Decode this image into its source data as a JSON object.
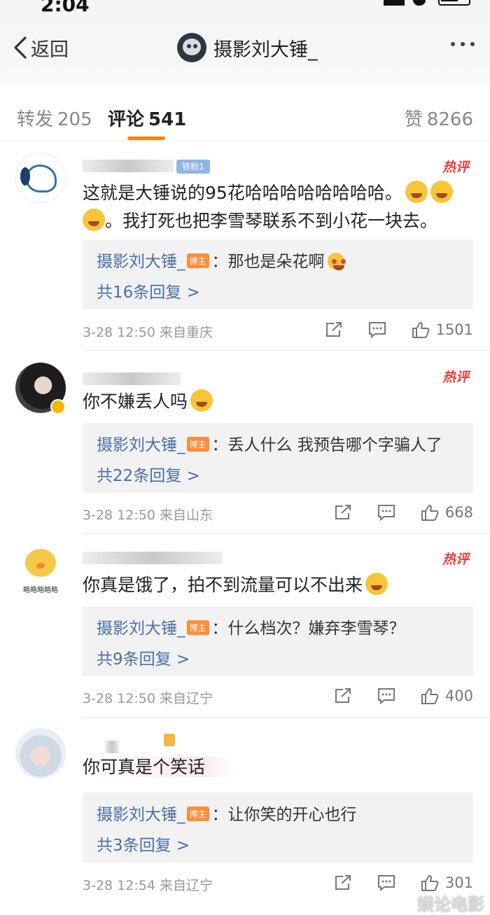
{
  "status": {
    "time": "2:04"
  },
  "nav": {
    "back_label": "返回",
    "title": "摄影刘大锤_"
  },
  "tabs": {
    "repost_label": "转发",
    "repost_count": "205",
    "comment_label": "评论",
    "comment_count": "541",
    "like_label": "赞",
    "like_count": "8266"
  },
  "comments": [
    {
      "fan_badge": "铁粉1",
      "hot_label": "热评",
      "text_part1": "这就是大锤说的95花哈哈哈哈哈哈哈哈。",
      "text_part2": "。我打死也把李雪琴联系不到小花一块去。",
      "reply": {
        "author": "摄影刘大锤_",
        "badge": "博主",
        "text": "：那也是朵花啊",
        "more": "共16条回复 >"
      },
      "time": "3-28 12:50",
      "source": "来自重庆",
      "likes": "1501"
    },
    {
      "hot_label": "热评",
      "text": "你不嫌丢人吗",
      "reply": {
        "author": "摄影刘大锤_",
        "badge": "博主",
        "text": "：丢人什么 我预告哪个字骗人了",
        "more": "共22条回复 >"
      },
      "time": "3-28 12:50",
      "source": "来自山东",
      "likes": "668"
    },
    {
      "hot_label": "热评",
      "avatar_caption": "略略略略略",
      "text": "你真是饿了，拍不到流量可以不出来",
      "reply": {
        "author": "摄影刘大锤_",
        "badge": "博主",
        "text": "：什么档次？嫌弃李雪琴？",
        "more": "共9条回复 >"
      },
      "time": "3-28 12:50",
      "source": "来自辽宁",
      "likes": "400"
    },
    {
      "text": "你可真是个笑话",
      "reply": {
        "author": "摄影刘大锤_",
        "badge": "博主",
        "text": "：让你笑的开心也行",
        "more": "共3条回复 >"
      },
      "time": "3-28 12:54",
      "source": "来自辽宁",
      "likes": "301"
    }
  ],
  "watermark": "娱论电影",
  "icons": [
    "back-chevron-icon",
    "more-dots-icon",
    "share-icon",
    "comment-icon",
    "like-thumb-icon"
  ],
  "colors": {
    "accent": "#ff8200",
    "link": "#4a70a8",
    "hot": "#e8423c",
    "reply_bg": "#f2f2f2"
  }
}
